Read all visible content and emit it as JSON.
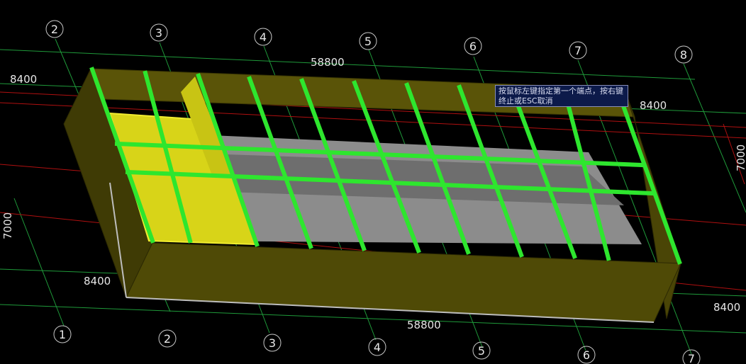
{
  "axes": {
    "top": [
      "2",
      "3",
      "4",
      "5",
      "6",
      "7",
      "8"
    ],
    "bottom": [
      "1",
      "2",
      "3",
      "4",
      "5",
      "6",
      "7"
    ]
  },
  "dimensions": {
    "top_span": "58800",
    "bottom_span": "58800",
    "left_top_bay": "8400",
    "left_bottom_bay": "8400",
    "right_top_bay": "8400",
    "right_bottom_bay": "8400",
    "left_depth": "7000",
    "right_depth": "7000"
  },
  "tooltip": {
    "text": "按鼠标左键指定第一个端点，按右键终止或ESC取消"
  },
  "colors": {
    "background": "#000000",
    "grid_green": "#1f9a3a",
    "grid_red": "#b01010",
    "wall_olive": "#4f4a06",
    "beam_green": "#2ee62e",
    "selected_yellow": "#d8d418",
    "slab_gray": "#8c8c8c"
  }
}
